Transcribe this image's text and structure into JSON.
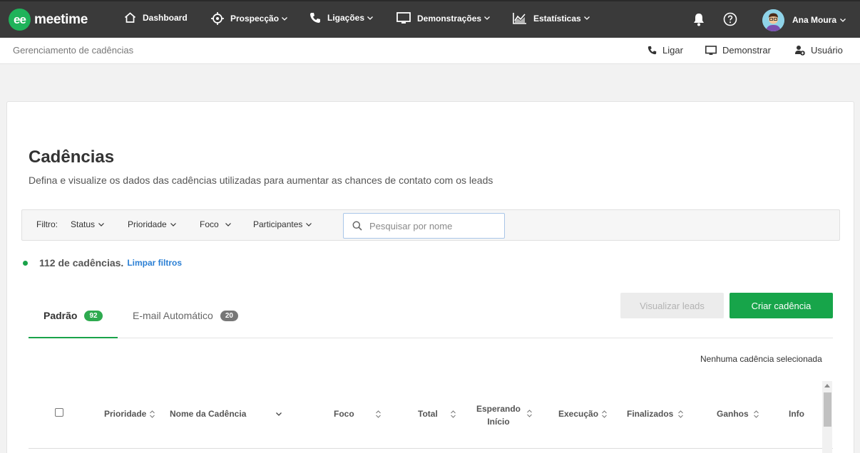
{
  "brand": {
    "name": "meetime",
    "mark": "ee"
  },
  "nav": {
    "items": [
      {
        "label": "Dashboard",
        "icon": "home-icon"
      },
      {
        "label": "Prospecção",
        "icon": "target-icon"
      },
      {
        "label": "Ligações",
        "icon": "phone-icon"
      },
      {
        "label": "Demonstrações",
        "icon": "monitor-icon"
      },
      {
        "label": "Estatísticas",
        "icon": "chart-icon"
      }
    ],
    "user_name": "Ana Moura"
  },
  "subheader": {
    "title": "Gerenciamento de cadências",
    "actions": [
      {
        "label": "Ligar",
        "icon": "phone-icon"
      },
      {
        "label": "Demonstrar",
        "icon": "monitor-icon"
      },
      {
        "label": "Usuário",
        "icon": "add-user-icon"
      }
    ]
  },
  "page": {
    "title": "Cadências",
    "description": "Defina e visualize os dados das cadências utilizadas para aumentar as chances de contato com os leads"
  },
  "filters": {
    "label": "Filtro:",
    "dropdowns": [
      "Status",
      "Prioridade",
      "Foco",
      "Participantes"
    ],
    "search_placeholder": "Pesquisar por nome"
  },
  "summary": {
    "count_text": "112 de cadências.",
    "clear_label": "Limpar filtros"
  },
  "tabs": [
    {
      "label": "Padrão",
      "count": "92",
      "active": true
    },
    {
      "label": "E-mail Automático",
      "count": "20",
      "active": false
    }
  ],
  "buttons": {
    "view_leads": "Visualizar leads",
    "create": "Criar cadência"
  },
  "selection_text": "Nenhuma cadência selecionada",
  "table": {
    "columns": [
      "Prioridade",
      "Nome da Cadência",
      "Foco",
      "Total",
      "Esperando",
      "Início",
      "Execução",
      "Finalizados",
      "Ganhos",
      "Info"
    ]
  },
  "colors": {
    "navbar": "#3a3a3a",
    "accent_green": "#17a54a",
    "link_blue": "#2a7fd4",
    "badge_gray": "#777777"
  }
}
